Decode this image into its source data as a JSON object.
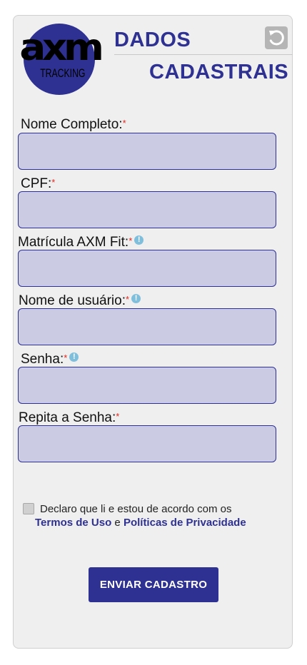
{
  "logo": {
    "wordmark": "axm",
    "subtitle": "TRACKING"
  },
  "header": {
    "title_line1": "DADOS",
    "title_line2": "CADASTRAIS",
    "reset_icon": "reset-icon"
  },
  "form": {
    "fields": [
      {
        "label": "Nome Completo:",
        "required_mark": "*",
        "has_info": false,
        "value": "",
        "placeholder": ""
      },
      {
        "label": "CPF:",
        "required_mark": "*",
        "has_info": false,
        "value": "",
        "placeholder": ""
      },
      {
        "label": "Matrícula AXM Fit:",
        "required_mark": "*",
        "has_info": true,
        "value": "",
        "placeholder": ""
      },
      {
        "label": "Nome de usuário:",
        "required_mark": "*",
        "has_info": true,
        "value": "",
        "placeholder": ""
      },
      {
        "label": "Senha:",
        "required_mark": "*",
        "has_info": true,
        "value": "",
        "placeholder": ""
      },
      {
        "label": "Repita a Senha:",
        "required_mark": "*",
        "has_info": false,
        "value": "",
        "placeholder": ""
      }
    ],
    "info_glyph": "!"
  },
  "terms": {
    "checked": false,
    "text_before": "Declaro que li e estou de acordo com os",
    "link_terms": "Termos de Uso",
    "connector": " e ",
    "link_privacy": "Políticas de Privacidade"
  },
  "submit": {
    "label": "ENVIAR CADASTRO"
  },
  "colors": {
    "brand": "#2e3191",
    "input_bg": "#cbcbe3",
    "required": "#e0281e",
    "info": "#7fbfdc",
    "card_bg": "#efefef"
  }
}
